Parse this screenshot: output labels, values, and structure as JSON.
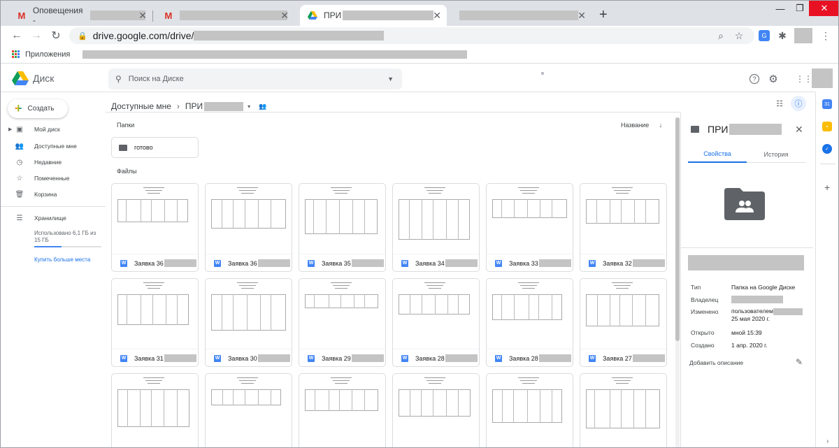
{
  "browser": {
    "tabs": [
      {
        "title": "Оповещения -",
        "favicon": "gmail-icon",
        "active": false
      },
      {
        "title": "",
        "favicon": "gmail-icon",
        "active": false
      },
      {
        "title": "ПРИ",
        "favicon": "drive-icon",
        "active": true
      },
      {
        "title": "",
        "favicon": "",
        "active": false
      }
    ],
    "url": "drive.google.com/drive/",
    "bookmarks_label": "Приложения"
  },
  "drive": {
    "brand": "Диск",
    "search_placeholder": "Поиск на Диске",
    "create_label": "Создать",
    "nav": [
      {
        "label": "Мой диск",
        "icon": "my-drive-icon"
      },
      {
        "label": "Доступные мне",
        "icon": "shared-icon"
      },
      {
        "label": "Недавние",
        "icon": "recent-icon"
      },
      {
        "label": "Помеченные",
        "icon": "star-icon"
      },
      {
        "label": "Корзина",
        "icon": "trash-icon"
      }
    ],
    "storage_label": "Хранилище",
    "storage_used": "Использовано 6,1 ГБ из 15 ГБ",
    "storage_fraction": 0.41,
    "buy_more": "Купить больше места"
  },
  "main": {
    "breadcrumb_root": "Доступные мне",
    "breadcrumb_current": "ПРИ",
    "folders_label": "Папки",
    "files_label": "Файлы",
    "sort_label": "Название",
    "folders": [
      {
        "name": "готово"
      }
    ],
    "files": [
      {
        "name": "Заявка 36"
      },
      {
        "name": "Заявка 36"
      },
      {
        "name": "Заявка 35"
      },
      {
        "name": "Заявка 34"
      },
      {
        "name": "Заявка 33"
      },
      {
        "name": "Заявка 32"
      },
      {
        "name": "Заявка 31"
      },
      {
        "name": "Заявка 30"
      },
      {
        "name": "Заявка 29"
      },
      {
        "name": "Заявка 28"
      },
      {
        "name": "Заявка 28"
      },
      {
        "name": "Заявка 27"
      },
      {
        "name": ""
      },
      {
        "name": ""
      },
      {
        "name": ""
      },
      {
        "name": ""
      },
      {
        "name": ""
      },
      {
        "name": ""
      }
    ]
  },
  "details": {
    "title": "ПРИ",
    "tab_properties": "Свойства",
    "tab_history": "История",
    "props": [
      {
        "key": "Тип",
        "value": "Папка на Google Диске"
      },
      {
        "key": "Владелец",
        "value": ""
      },
      {
        "key": "Изменено",
        "value": "пользователем",
        "value2": "25 мая 2020 г."
      },
      {
        "key": "Открыто",
        "value": "мной 15:39"
      },
      {
        "key": "Создано",
        "value": "1 апр. 2020 г."
      }
    ],
    "add_description": "Добавить описание"
  },
  "colors": {
    "accent": "#1a73e8",
    "gmail_red": "#d93025",
    "close_red": "#e81123"
  }
}
